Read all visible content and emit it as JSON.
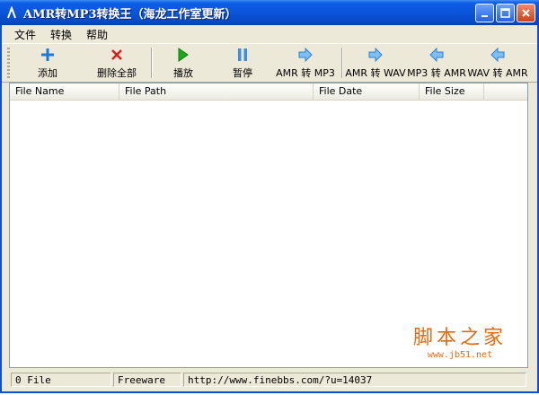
{
  "window": {
    "title": "AMR转MP3转换王（海龙工作室更新）",
    "controls": [
      "minimize-icon",
      "maximize-icon",
      "close-icon"
    ]
  },
  "menu": [
    "文件",
    "转换",
    "帮助"
  ],
  "toolbar": {
    "add": "添加",
    "delete_all": "删除全部",
    "play": "播放",
    "pause": "暂停",
    "amr_to_mp3": "AMR 转 MP3",
    "amr_to_wav": "AMR 转 WAV",
    "mp3_to_amr": "MP3 转 AMR",
    "wav_to_amr": "WAV 转 AMR"
  },
  "table": {
    "columns": [
      "File Name",
      "File Path",
      "File Date",
      "File Size"
    ],
    "rows": []
  },
  "watermark": {
    "title": "脚本之家",
    "url": "www.jb51.net"
  },
  "status": {
    "count": "0 File",
    "license": "Freeware",
    "url": "http://www.finebbs.com/?u=14037"
  },
  "colors": {
    "titlebar": "#0a55d9",
    "arrow": "#3a8ee6",
    "add": "#1e78d8",
    "delete": "#d81e1e",
    "play": "#1ea81e"
  }
}
